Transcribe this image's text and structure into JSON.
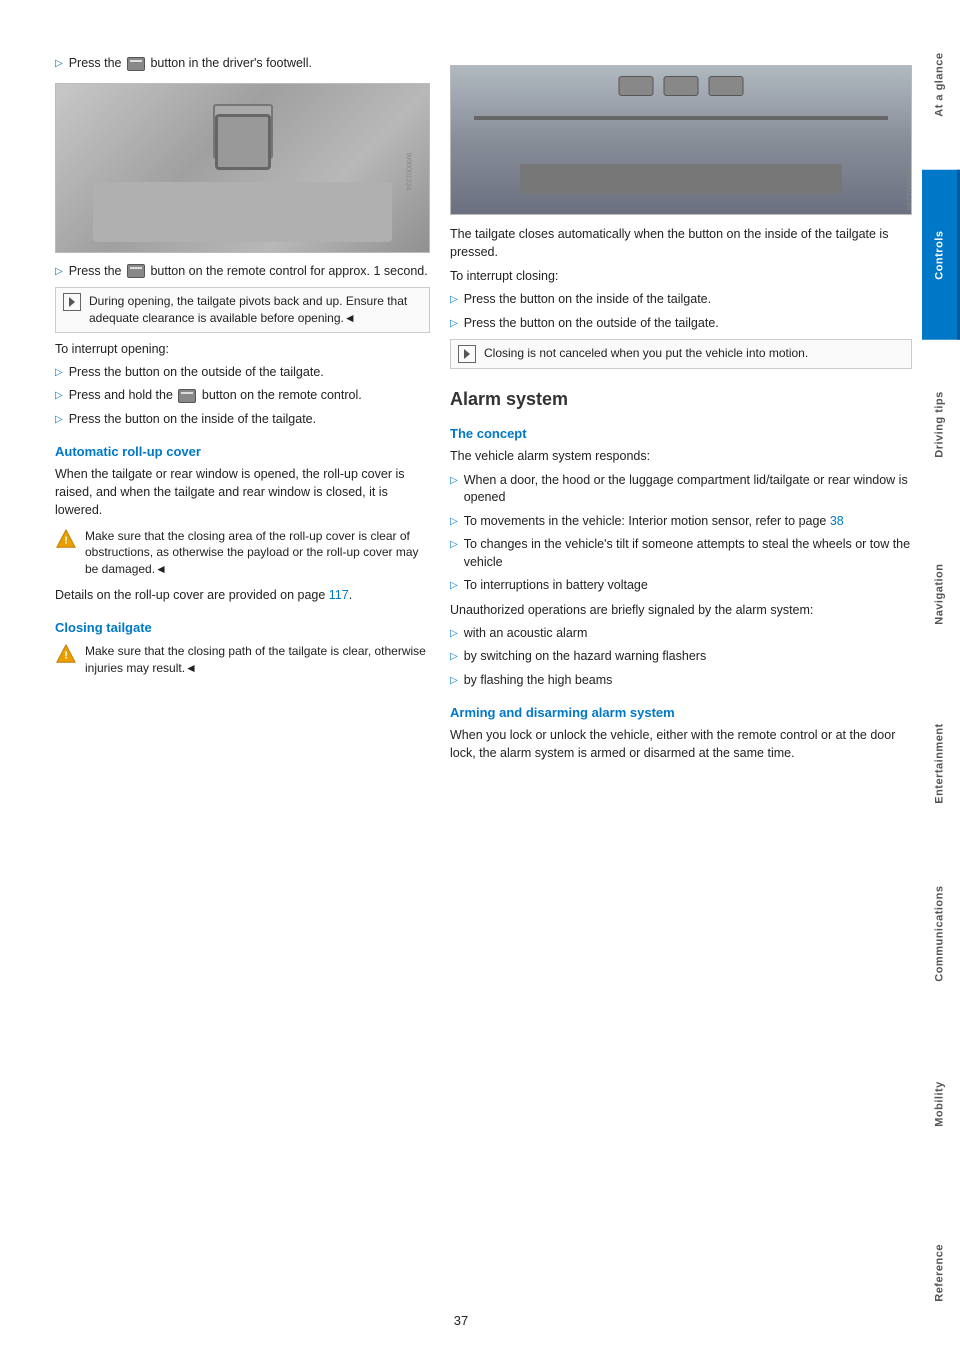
{
  "page": {
    "number": "37"
  },
  "sidebar": {
    "items": [
      {
        "label": "At a glance",
        "active": false
      },
      {
        "label": "Controls",
        "active": true
      },
      {
        "label": "Driving tips",
        "active": false
      },
      {
        "label": "Navigation",
        "active": false
      },
      {
        "label": "Entertainment",
        "active": false
      },
      {
        "label": "Communications",
        "active": false
      },
      {
        "label": "Mobility",
        "active": false
      },
      {
        "label": "Reference",
        "active": false
      }
    ]
  },
  "left_column": {
    "intro_bullet": "Press the [icon] button in the driver's footwell.",
    "bullets_interrupt": [
      "Press the button on the outside of the tailgate.",
      "Press and hold the [icon] button on the remote control.",
      "Press the button on the inside of the tailgate."
    ],
    "notice_opening": "During opening, the tailgate pivots back and up. Ensure that adequate clearance is available before opening.",
    "interrupt_heading": "To interrupt opening:",
    "auto_rollup_heading": "Automatic roll-up cover",
    "auto_rollup_text": "When the tailgate or rear window is opened, the roll-up cover is raised, and when the tailgate and rear window is closed, it is lowered.",
    "warning_rollup": "Make sure that the closing area of the roll-up cover is clear of obstructions, as otherwise the payload or the roll-up cover may be damaged.",
    "rollup_details": "Details on the roll-up cover are provided on page 117.",
    "closing_heading": "Closing tailgate",
    "closing_warning": "Make sure that the closing path of the tailgate is clear, otherwise injuries may result."
  },
  "right_column": {
    "tailgate_text": "The tailgate closes automatically when the button on the inside of the tailgate is pressed.",
    "interrupt_closing_heading": "To interrupt closing:",
    "interrupt_closing_bullets": [
      "Press the button on the inside of the tailgate.",
      "Press the button on the outside of the tailgate."
    ],
    "notice_closing": "Closing is not canceled when you put the vehicle into motion.",
    "alarm_heading": "Alarm system",
    "concept_heading": "The concept",
    "concept_intro": "The vehicle alarm system responds:",
    "concept_bullets": [
      "When a door, the hood or the luggage compartment lid/tailgate or rear window is opened",
      "To movements in the vehicle: Interior motion sensor, refer to page 38",
      "To changes in the vehicle's tilt if someone attempts to steal the wheels or tow the vehicle",
      "To interruptions in battery voltage"
    ],
    "unauthorized_intro": "Unauthorized operations are briefly signaled by the alarm system:",
    "unauthorized_bullets": [
      "with an acoustic alarm",
      "by switching on the hazard warning flashers",
      "by flashing the high beams"
    ],
    "arming_heading": "Arming and disarming alarm system",
    "arming_text": "When you lock or unlock the vehicle, either with the remote control or at the door lock, the alarm system is armed or disarmed at the same time."
  }
}
